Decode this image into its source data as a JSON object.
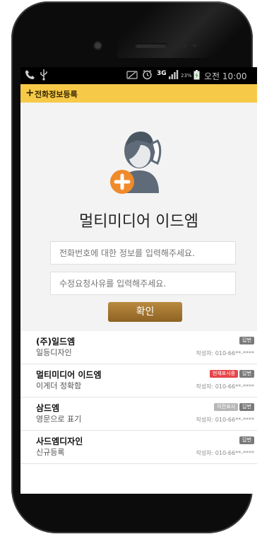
{
  "statusbar": {
    "left_icons": [
      "phone-icon",
      "usb-icon"
    ],
    "right_icons": [
      "no-sim-icon",
      "alarm-icon",
      "3g-icon",
      "signal-icon",
      "battery-icon"
    ],
    "three_g": "3G",
    "battery_percent": "23%",
    "time": "오전 10:00"
  },
  "titlebar": {
    "plus": "+",
    "title": "전화정보등록"
  },
  "hero": {
    "app_name": "멀티미디어 이드엠",
    "phone_input": {
      "value": "",
      "placeholder": "전화번호에 대한 정보를 입력해주세요."
    },
    "reason_input": {
      "value": "",
      "placeholder": "수정요청사유를 입력해주세요."
    },
    "confirm_label": "확인"
  },
  "list": {
    "items": [
      {
        "title": "(주)일드엠",
        "subtitle": "일등디자인",
        "author": "작성자: 010-66**-****",
        "badges": [
          {
            "label": "답변",
            "color": "#7a7a7a"
          }
        ]
      },
      {
        "title": "멀티미디어 이드엠",
        "subtitle": "이게더 정확함",
        "author": "작성자: 010-66**-****",
        "badges": [
          {
            "label": "현재표시중",
            "color": "#e5454a"
          },
          {
            "label": "답변",
            "color": "#7a7a7a"
          }
        ]
      },
      {
        "title": "삼드엠",
        "subtitle": "영문으로 표기",
        "author": "작성자: 010-66**-****",
        "badges": [
          {
            "label": "이전표시",
            "color": "#b7b7b7"
          },
          {
            "label": "답변",
            "color": "#7a7a7a"
          }
        ]
      },
      {
        "title": "사드엠디자인",
        "subtitle": "신규등록",
        "author": "작성자: 010-66**-****",
        "badges": [
          {
            "label": "답변",
            "color": "#7a7a7a"
          }
        ]
      }
    ]
  },
  "colors": {
    "titlebar": "#f7c948",
    "accent_button": "#a0742e",
    "plus_badge": "#f08a2a"
  }
}
